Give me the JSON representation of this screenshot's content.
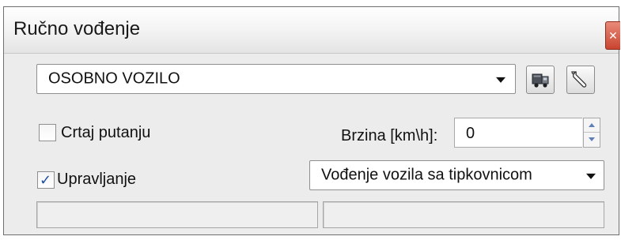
{
  "window": {
    "title": "Ručno vođenje",
    "close_glyph": "✕"
  },
  "vehicle": {
    "selected": "OSOBNO VOZILO",
    "options": [
      "OSOBNO VOZILO"
    ]
  },
  "toolbar": {
    "vehicle_icon": "truck-icon",
    "settings_icon": "wrench-icon"
  },
  "draw_path": {
    "label": "Crtaj putanju",
    "checked": false
  },
  "speed": {
    "label": "Brzina [km\\h]:",
    "value": "0"
  },
  "control": {
    "label": "Upravljanje",
    "checked": true,
    "checkmark": "✓"
  },
  "mode": {
    "selected": "Vođenje vozila sa tipkovnicom",
    "options": [
      "Vođenje vozila sa tipkovnicom"
    ]
  },
  "status": {
    "left": "",
    "right": ""
  },
  "colors": {
    "accent": "#1f4fa8",
    "close": "#c9442f"
  }
}
